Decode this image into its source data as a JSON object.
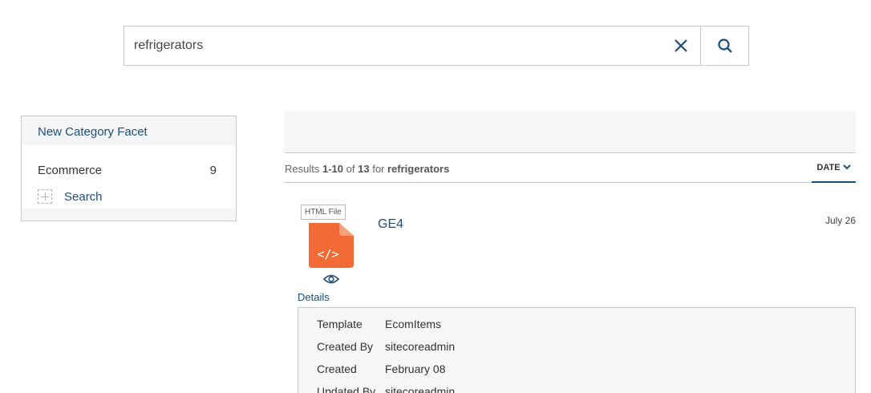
{
  "search": {
    "value": "refrigerators",
    "clear_icon": "close-icon",
    "submit_icon": "search-icon"
  },
  "facet": {
    "title": "New Category Facet",
    "items": [
      {
        "label": "Ecommerce",
        "count": "9"
      }
    ],
    "search_label": "Search"
  },
  "results": {
    "summary_prefix": "Results",
    "range": "1-10",
    "of_text": "of",
    "total": "13",
    "for_text": "for",
    "query": "refrigerators",
    "sort_label": "DATE",
    "items": [
      {
        "file_type": "HTML File",
        "file_icon_glyph": "</>",
        "title": "GE4",
        "date": "July 26",
        "details_label": "Details",
        "details": [
          {
            "key": "Template",
            "value": "EcomItems"
          },
          {
            "key": "Created By",
            "value": "sitecoreadmin"
          },
          {
            "key": "Created",
            "value": "February 08"
          },
          {
            "key": "Updated By",
            "value": "sitecoreadmin"
          }
        ]
      }
    ]
  },
  "colors": {
    "accent": "#1f4e79",
    "file_icon": "#f26a36",
    "panel_bg": "#f5f6f7",
    "border": "#c9c9c9"
  }
}
